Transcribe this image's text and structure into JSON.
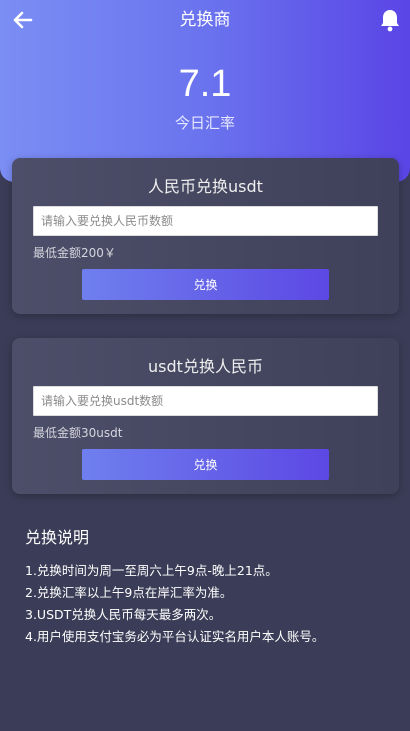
{
  "header": {
    "title": "兑换商",
    "back_icon": "arrow-left-icon",
    "bell_icon": "bell-icon",
    "rate_value": "7.1",
    "rate_label": "今日汇率"
  },
  "card_cny_to_usdt": {
    "title": "人民币兑换usdt",
    "placeholder": "请输入要兑换人民币数额",
    "value": "",
    "min_hint": "最低金额200￥",
    "button_label": "兑换"
  },
  "card_usdt_to_cny": {
    "title": "usdt兑换人民币",
    "placeholder": "请输入要兑换usdt数额",
    "value": "",
    "min_hint": "最低金额30usdt",
    "button_label": "兑换"
  },
  "notes": {
    "title": "兑换说明",
    "items": [
      "1.兑换时间为周一至周六上午9点-晚上21点。",
      "2.兑换汇率以上午9点在岸汇率为准。",
      "3.USDT兑换人民币每天最多两次。",
      "4.用户使用支付宝务必为平台认证实名用户本人账号。"
    ]
  },
  "colors": {
    "hero_start": "#7b8ef4",
    "hero_end": "#5a45e6",
    "background": "#3b3c57",
    "button_start": "#6f7fee",
    "button_end": "#5c48e4"
  }
}
